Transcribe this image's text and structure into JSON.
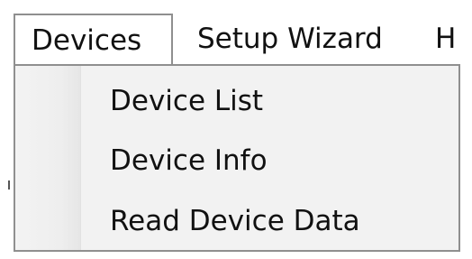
{
  "menubar": {
    "items": [
      {
        "label": "Devices",
        "state": "open"
      },
      {
        "label": "Setup Wizard"
      },
      {
        "label": "H"
      }
    ]
  },
  "dropdown": {
    "items": [
      {
        "label": "Device List"
      },
      {
        "label": "Device Info"
      },
      {
        "label": "Read Device Data"
      }
    ]
  },
  "colors": {
    "menu_border": "#8f8f8f",
    "dropdown_bg": "#f2f2f2",
    "text": "#111111"
  }
}
